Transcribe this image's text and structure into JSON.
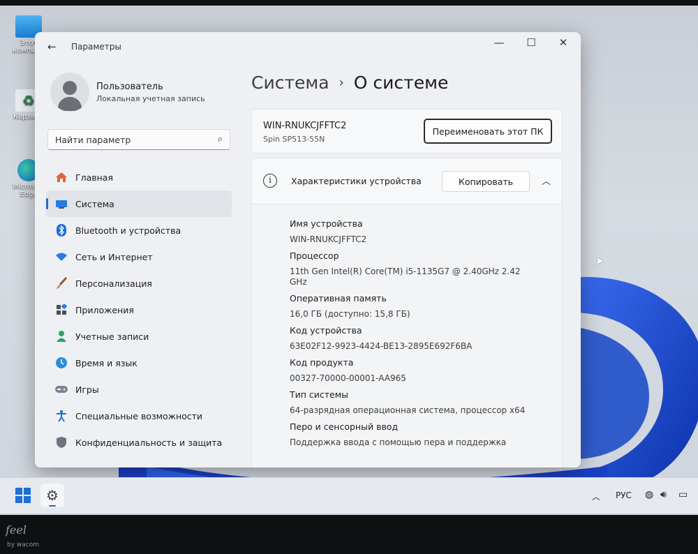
{
  "desktop": {
    "icons": [
      {
        "label": "Этот компьютер",
        "icon": "computer-icon"
      },
      {
        "label": "Корзина",
        "icon": "recycle-bin-icon"
      },
      {
        "label": "Microsoft Edge",
        "icon": "edge-icon"
      }
    ]
  },
  "window": {
    "title": "Параметры",
    "controls": {
      "minimize": "—",
      "maximize": "☐",
      "close": "✕"
    }
  },
  "user": {
    "name": "Пользователь",
    "account_type": "Локальная учетная запись"
  },
  "search": {
    "placeholder": "Найти параметр"
  },
  "nav": {
    "items": [
      {
        "label": "Главная",
        "icon": "home-icon"
      },
      {
        "label": "Система",
        "icon": "system-icon",
        "active": true
      },
      {
        "label": "Bluetooth и устройства",
        "icon": "bluetooth-icon"
      },
      {
        "label": "Сеть и Интернет",
        "icon": "wifi-icon"
      },
      {
        "label": "Персонализация",
        "icon": "brush-icon"
      },
      {
        "label": "Приложения",
        "icon": "apps-icon"
      },
      {
        "label": "Учетные записи",
        "icon": "accounts-icon"
      },
      {
        "label": "Время и язык",
        "icon": "time-language-icon"
      },
      {
        "label": "Игры",
        "icon": "gamepad-icon"
      },
      {
        "label": "Специальные возможности",
        "icon": "accessibility-icon"
      },
      {
        "label": "Конфиденциальность и защита",
        "icon": "shield-icon"
      }
    ]
  },
  "breadcrumb": {
    "parent": "Система",
    "separator": "›",
    "current": "О системе"
  },
  "pc": {
    "name": "WIN-RNUKCJFFTC2",
    "model": "Spin SP513-55N",
    "rename_label": "Переименовать этот ПК"
  },
  "specs": {
    "title": "Характеристики устройства",
    "copy_label": "Копировать",
    "rows": [
      {
        "label": "Имя устройства",
        "value": "WIN-RNUKCJFFTC2"
      },
      {
        "label": "Процессор",
        "value": "11th Gen Intel(R) Core(TM) i5-1135G7 @ 2.40GHz   2.42 GHz"
      },
      {
        "label": "Оперативная память",
        "value": "16,0 ГБ (доступно: 15,8 ГБ)"
      },
      {
        "label": "Код устройства",
        "value": "63E02F12-9923-4424-BE13-2895E692F6BA"
      },
      {
        "label": "Код продукта",
        "value": "00327-70000-00001-AA965"
      },
      {
        "label": "Тип системы",
        "value": "64-разрядная операционная система, процессор x64"
      },
      {
        "label": "Перо и сенсорный ввод",
        "value": "Поддержка ввода с помощью пера и поддержка"
      }
    ]
  },
  "taskbar": {
    "language": "РУС"
  },
  "bezel": {
    "logo": "feel",
    "sub": "by wacom"
  },
  "colors": {
    "accent": "#2a68c8",
    "bloom": "#1446c8"
  }
}
